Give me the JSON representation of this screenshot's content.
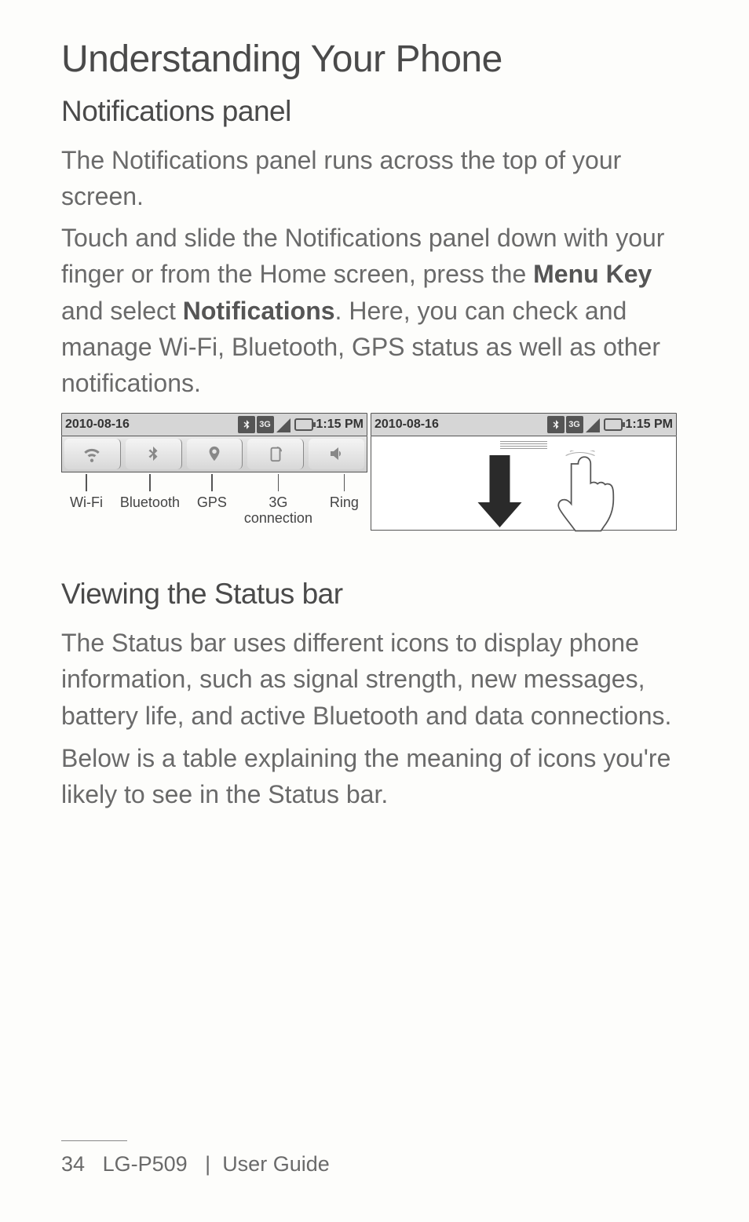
{
  "page_title": "Understanding Your Phone",
  "section1": {
    "heading": "Notifications panel",
    "para1": "The Notifications panel runs across the top of your screen.",
    "para2_a": "Touch and slide the Notifications panel down with your finger or from the Home screen, press the ",
    "para2_bold1": "Menu Key",
    "para2_b": " and select ",
    "para2_bold2": "Notifications",
    "para2_c": ". Here, you can check and manage Wi-Fi, Bluetooth, GPS status as well as other notifications."
  },
  "fig_left": {
    "date": "2010-08-16",
    "time": "1:15 PM",
    "threeg_label": "3G",
    "toggles": [
      {
        "label": "Wi-Fi"
      },
      {
        "label": "Bluetooth"
      },
      {
        "label": "GPS"
      },
      {
        "label_line1": "3G",
        "label_line2": "connection"
      },
      {
        "label": "Ring"
      }
    ]
  },
  "fig_right": {
    "date": "2010-08-16",
    "time": "1:15 PM",
    "threeg_label": "3G"
  },
  "section2": {
    "heading": "Viewing the Status bar",
    "para1": "The Status bar uses different icons to display phone information, such as signal strength, new messages, battery life, and active Bluetooth and data connections.",
    "para2": "Below is a table explaining the meaning of icons you're likely to see in the Status bar."
  },
  "footer": {
    "page_number": "34",
    "model": "LG-P509",
    "sep": "|",
    "guide": "User Guide"
  }
}
